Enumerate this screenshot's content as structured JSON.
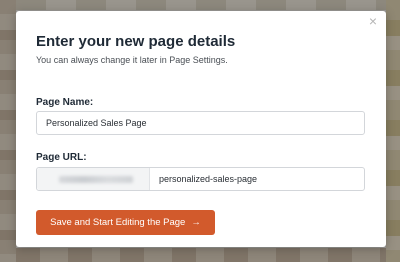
{
  "dialog": {
    "close_glyph": "×",
    "title": "Enter your new page details",
    "subtitle": "You can always change it later in Page Settings."
  },
  "fields": {
    "page_name": {
      "label": "Page Name:",
      "value": "Personalized Sales Page"
    },
    "page_url": {
      "label": "Page URL:",
      "slug": "personalized-sales-page"
    }
  },
  "actions": {
    "primary_label": "Save and Start Editing the Page",
    "primary_arrow": "→"
  },
  "colors": {
    "accent": "#d25a2c",
    "title": "#1f2a36"
  }
}
